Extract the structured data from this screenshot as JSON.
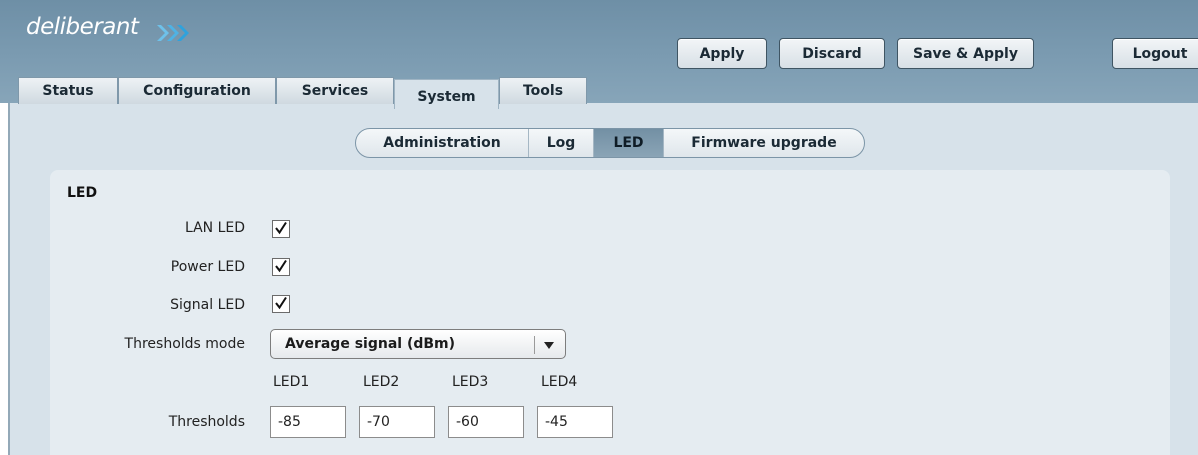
{
  "brand": {
    "logo_text": "deliberant"
  },
  "toolbar": {
    "apply_label": "Apply",
    "discard_label": "Discard",
    "save_apply_label": "Save & Apply",
    "logout_label": "Logout"
  },
  "tabs": [
    {
      "label": "Status"
    },
    {
      "label": "Configuration"
    },
    {
      "label": "Services"
    },
    {
      "label": "System",
      "active": true
    },
    {
      "label": "Tools"
    }
  ],
  "subnav": [
    {
      "label": "Administration"
    },
    {
      "label": "Log"
    },
    {
      "label": "LED",
      "active": true
    },
    {
      "label": "Firmware upgrade"
    }
  ],
  "led_section": {
    "title": "LED",
    "lan_led_label": "LAN LED",
    "lan_led_checked": true,
    "power_led_label": "Power LED",
    "power_led_checked": true,
    "signal_led_label": "Signal LED",
    "signal_led_checked": true,
    "thresholds_mode_label": "Thresholds mode",
    "thresholds_mode_value": "Average signal (dBm)",
    "thresholds_label": "Thresholds",
    "led_columns": [
      "LED1",
      "LED2",
      "LED3",
      "LED4"
    ],
    "threshold_values": [
      "-85",
      "-70",
      "-60",
      "-45"
    ]
  },
  "icons": {
    "dropdown": "chevron-down-icon",
    "check": "check-icon"
  },
  "colors": {
    "header": "#7b9bb1",
    "content_bg": "#d7e2ea",
    "panel_bg": "#e5ecf1",
    "active_subtab": "#7d98ab"
  }
}
